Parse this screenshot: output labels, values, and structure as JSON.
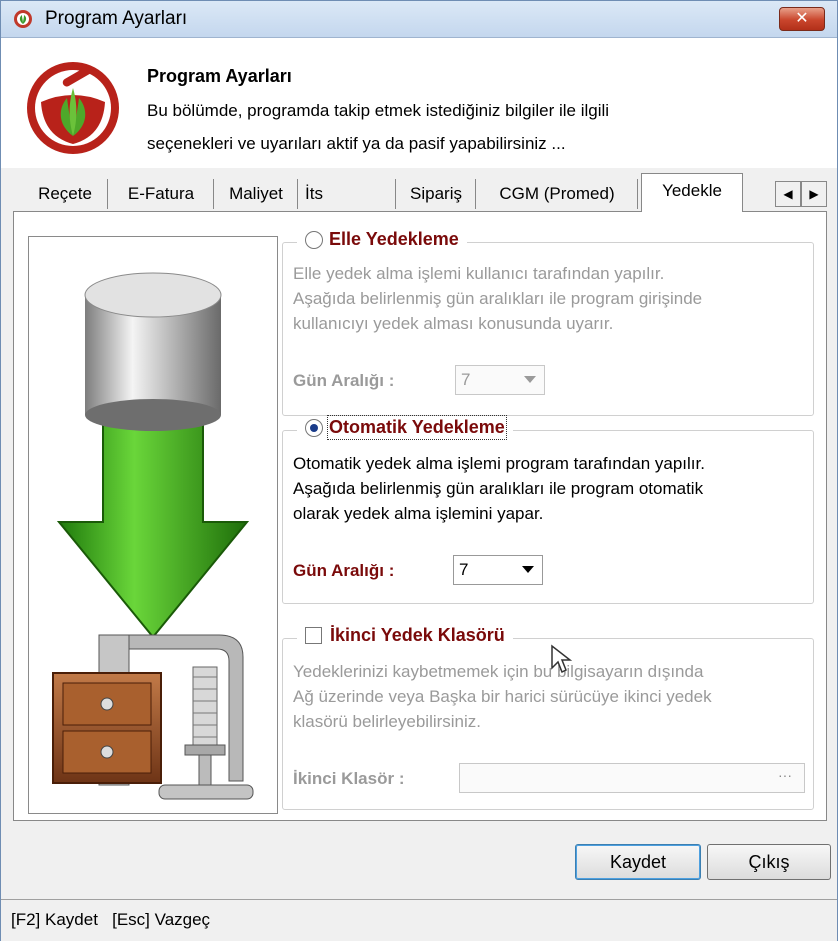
{
  "window": {
    "title": "Program Ayarları",
    "close_symbol": "✕"
  },
  "header": {
    "title": "Program Ayarları",
    "desc_line1": "Bu bölümde, programda takip etmek istediğiniz bilgiler ile ilgili",
    "desc_line2": "seçenekleri ve uyarıları aktif ya da pasif yapabilirsiniz ..."
  },
  "tabs": [
    "Reçete",
    "E-Fatura",
    "Maliyet",
    "İts",
    "Sipariş",
    "CGM (Promed)",
    "Yedekle"
  ],
  "active_tab": "Yedekle",
  "tab_scroll": {
    "left": "◀",
    "right": "▶"
  },
  "manual": {
    "title": "Elle Yedekleme",
    "selected": false,
    "line1": "Elle yedek alma işlemi kullanıcı tarafından yapılır.",
    "line2": "Aşağıda belirlenmiş gün aralıkları ile program girişinde",
    "line3": "kullanıcıyı yedek alması konusunda uyarır.",
    "interval_label": "Gün Aralığı :",
    "interval_value": "7",
    "enabled": false
  },
  "auto": {
    "title": "Otomatik Yedekleme",
    "selected": true,
    "line1": "Otomatik yedek alma işlemi program tarafından yapılır.",
    "line2": "Aşağıda belirlenmiş gün aralıkları ile program otomatik",
    "line3": "olarak yedek alma işlemini yapar.",
    "interval_label": "Gün Aralığı :",
    "interval_value": "7",
    "enabled": true
  },
  "second": {
    "title": "İkinci Yedek Klasörü",
    "checked": false,
    "line1": "Yedeklerinizi kaybetmemek için bu bilgisayarın dışında",
    "line2": "Ağ üzerinde veya Başka bir harici sürücüye ikinci yedek",
    "line3": "klasörü belirleyebilirsiniz.",
    "folder_label": "İkinci Klasör :",
    "folder_value": "",
    "browse_label": "···"
  },
  "buttons": {
    "save": "Kaydet",
    "exit": "Çıkış"
  },
  "status": {
    "text": "[F2] Kaydet   [Esc] Vazgeç"
  },
  "colors": {
    "title_accent": "#7a0a0a",
    "arrow_green": "#2f9a14",
    "logo_red": "#b8221a"
  }
}
